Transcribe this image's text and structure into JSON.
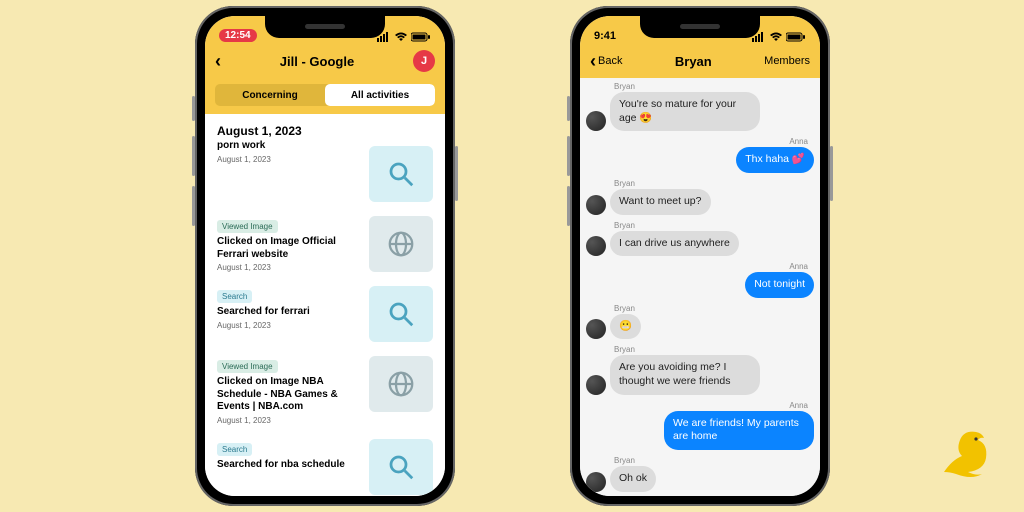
{
  "phone1": {
    "status": {
      "time": "12:54"
    },
    "header": {
      "title": "Jill - Google",
      "avatar_initial": "J"
    },
    "tabs": {
      "concerning": "Concerning",
      "all": "All activities"
    },
    "date_header": "August 1, 2023",
    "activities": [
      {
        "tag": "",
        "title_fragment": "porn work",
        "date": "August 1, 2023",
        "icon": "search"
      },
      {
        "tag": "Viewed Image",
        "title": "Clicked on Image Official Ferrari website",
        "date": "August 1, 2023",
        "icon": "globe"
      },
      {
        "tag": "Search",
        "title": "Searched for ferrari",
        "date": "August 1, 2023",
        "icon": "search"
      },
      {
        "tag": "Viewed Image",
        "title": "Clicked on Image NBA Schedule - NBA Games & Events | NBA.com",
        "date": "August 1, 2023",
        "icon": "globe"
      },
      {
        "tag": "Search",
        "title": "Searched for nba schedule",
        "date": "",
        "icon": "search"
      }
    ]
  },
  "phone2": {
    "status": {
      "time": "9:41"
    },
    "header": {
      "back": "Back",
      "title": "Bryan",
      "members": "Members"
    },
    "messages": [
      {
        "from": "Bryan",
        "side": "left",
        "text": "You're so mature for your age 😍"
      },
      {
        "from": "Anna",
        "side": "right",
        "text": "Thx haha 💕"
      },
      {
        "from": "Bryan",
        "side": "left",
        "text": "Want to meet up?"
      },
      {
        "from": "Bryan",
        "side": "left",
        "text": "I can drive us anywhere"
      },
      {
        "from": "Anna",
        "side": "right",
        "text": "Not tonight"
      },
      {
        "from": "Bryan",
        "side": "left",
        "text": "😬"
      },
      {
        "from": "Bryan",
        "side": "left",
        "text": "Are you avoiding me? I thought we were friends"
      },
      {
        "from": "Anna",
        "side": "right",
        "text": "We are friends! My parents are home"
      },
      {
        "from": "Bryan",
        "side": "left",
        "text": "Oh ok"
      }
    ]
  }
}
